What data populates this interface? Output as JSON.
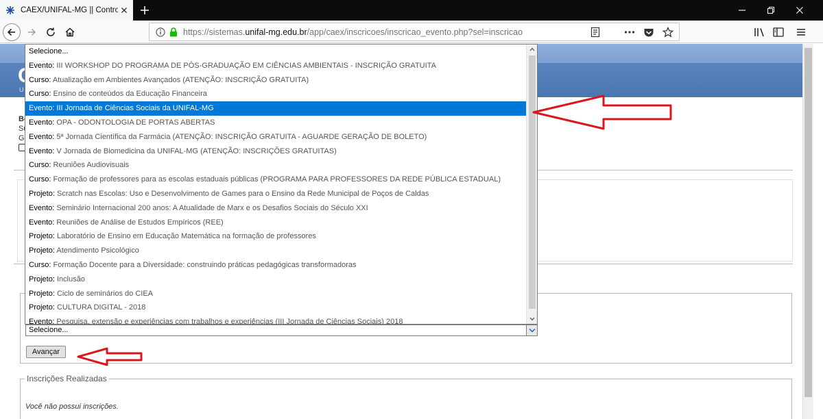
{
  "browser": {
    "tab_title": "CAEX/UNIFAL-MG || Controle d",
    "url_prefix": "https://sistemas.",
    "url_host": "unifal-mg.edu.br",
    "url_path": "/app/caex/inscricoes/inscricao_evento.php?sel=inscricao",
    "icons": {
      "favicon": "caex-favicon-icon",
      "tab_close": "close-icon",
      "new_tab": "plus-icon",
      "back": "back-arrow-icon",
      "forward": "forward-arrow-icon",
      "reload": "reload-icon",
      "home": "home-icon",
      "info": "info-icon",
      "lock": "lock-icon",
      "reader": "reader-view-icon",
      "more": "ellipsis-icon",
      "pocket": "pocket-icon",
      "bookmark": "star-icon",
      "library": "library-icon",
      "sidebar": "sidebar-icon",
      "menu": "hamburger-menu-icon",
      "minimize": "minimize-icon",
      "maximize": "restore-icon",
      "close_window": "close-window-icon"
    }
  },
  "page": {
    "logo": "C",
    "logo_sub": "U",
    "side_fragments": [
      "Bo",
      "Su",
      "Go"
    ],
    "tail_text": "z."
  },
  "dropdown": {
    "items": [
      {
        "type": "Selecione...",
        "name": ""
      },
      {
        "type": "Evento:",
        "name": "III WORKSHOP DO PROGRAMA DE PÓS-GRADUAÇÃO EM CIÊNCIAS AMBIENTAIS - INSCRIÇÃO GRATUITA"
      },
      {
        "type": "Curso:",
        "name": "Atualização em Ambientes Avançados (ATENÇÃO: INSCRIÇÃO GRATUITA)"
      },
      {
        "type": "Curso:",
        "name": "Ensino de conteúdos da Educação Financeira"
      },
      {
        "type": "Evento:",
        "name": "III Jornada de Ciências Sociais da UNIFAL-MG"
      },
      {
        "type": "Evento:",
        "name": "OPA - ODONTOLOGIA DE PORTAS ABERTAS"
      },
      {
        "type": "Evento:",
        "name": "5ª Jornada Científica da Farmácia (ATENÇÃO: INSCRIÇÃO GRATUITA - AGUARDE GERAÇÃO DE BOLETO)"
      },
      {
        "type": "Evento:",
        "name": "V Jornada de Biomedicina da UNIFAL-MG (ATENÇÃO: INSCRIÇÕES GRATUITAS)"
      },
      {
        "type": "Curso:",
        "name": "Reuniões Audiovisuais"
      },
      {
        "type": "Curso:",
        "name": "Formação de professores para as escolas estaduais públicas (PROGRAMA PARA PROFESSORES DA REDE PÚBLICA ESTADUAL)"
      },
      {
        "type": "Projeto:",
        "name": "Scratch nas Escolas: Uso e Desenvolvimento de Games para o Ensino da Rede Municipal de Poços de Caldas"
      },
      {
        "type": "Evento:",
        "name": "Seminário Internacional 200 anos: A Atualidade de Marx e os Desafios Sociais do Século XXI"
      },
      {
        "type": "Evento:",
        "name": "Reuniões de Análise de Estudos Empíricos (REE)"
      },
      {
        "type": "Projeto:",
        "name": "Laboratório de Ensino em Educação Matemática na formação de professores"
      },
      {
        "type": "Projeto:",
        "name": "Atendimento Psicológico"
      },
      {
        "type": "Curso:",
        "name": "Formação Docente para a Diversidade: construindo práticas pedagógicas transformadoras"
      },
      {
        "type": "Projeto:",
        "name": "Inclusão"
      },
      {
        "type": "Projeto:",
        "name": "Ciclo de seminários do CIEA"
      },
      {
        "type": "Projeto:",
        "name": "CULTURA DIGITAL - 2018"
      },
      {
        "type": "Evento:",
        "name": "Pesquisa, extensão e experiências com trabalhos e experiências (III Jornada de Ciências Sociais) 2018"
      }
    ],
    "selected_index": 4
  },
  "form": {
    "select_value": "Selecione...",
    "submit_label": "Avançar"
  },
  "inscricoes": {
    "legend": "Inscrições Realizadas",
    "empty_message": "Você não possui inscrições."
  },
  "colors": {
    "highlight": "#0078d7",
    "annotation": "#d9161b",
    "banner": "#4a76b1"
  }
}
